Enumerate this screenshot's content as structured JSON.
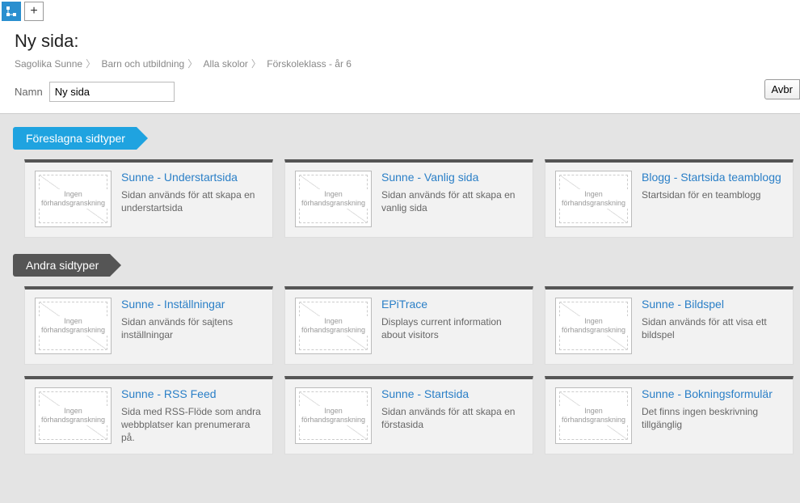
{
  "toolbar": {
    "plus": "+"
  },
  "header": {
    "title": "Ny sida:",
    "breadcrumb": [
      "Sagolika Sunne",
      "Barn och utbildning",
      "Alla skolor",
      "Förskoleklass - år 6"
    ],
    "name_label": "Namn",
    "name_value": "Ny sida",
    "cancel_label": "Avbr"
  },
  "thumb_text": "Ingen förhandsgranskning",
  "sections": {
    "suggested": {
      "label": "Föreslagna sidtyper",
      "items": [
        {
          "title": "Sunne - Understartsida",
          "desc": "Sidan används för att skapa en understartsida"
        },
        {
          "title": "Sunne - Vanlig sida",
          "desc": "Sidan används för att skapa en vanlig sida"
        },
        {
          "title": "Blogg - Startsida teamblogg",
          "desc": "Startsidan för en teamblogg"
        }
      ]
    },
    "other": {
      "label": "Andra sidtyper",
      "items": [
        {
          "title": "Sunne - Inställningar",
          "desc": "Sidan används för sajtens inställningar"
        },
        {
          "title": "EPiTrace",
          "desc": "Displays current information about visitors"
        },
        {
          "title": "Sunne - Bildspel",
          "desc": "Sidan används för att visa ett bildspel"
        },
        {
          "title": "Sunne - RSS Feed",
          "desc": "Sida med RSS-Flöde som andra webbplatser kan prenumerara på."
        },
        {
          "title": "Sunne - Startsida",
          "desc": "Sidan används för att skapa en förstasida"
        },
        {
          "title": "Sunne - Bokningsformulär",
          "desc": "Det finns ingen beskrivning tillgänglig"
        }
      ]
    }
  }
}
